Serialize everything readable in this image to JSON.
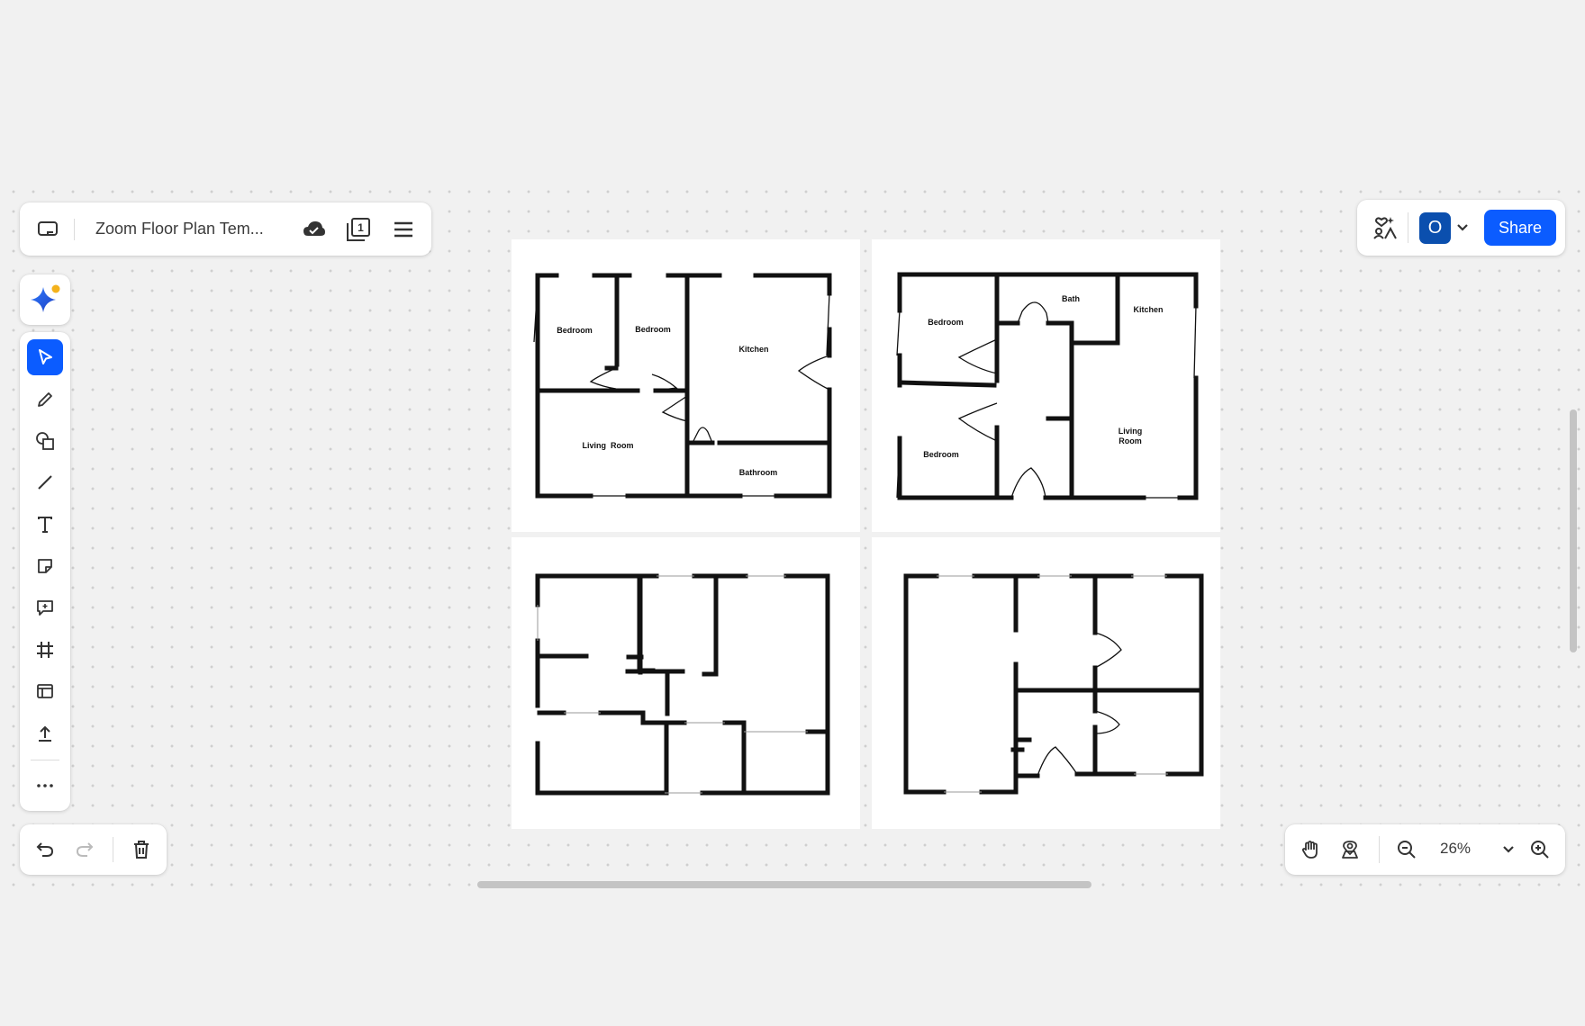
{
  "header": {
    "title": "Zoom Floor Plan Tem...",
    "back_icon": "board-back-icon",
    "cloud_icon": "cloud-saved-icon",
    "pages_icon": "pages-icon",
    "pages_count": "1",
    "menu_icon": "hamburger-menu-icon"
  },
  "ai_assistant": {
    "icon": "ai-sparkle-icon"
  },
  "toolbar": {
    "tools": [
      {
        "name": "select-tool",
        "icon": "pointer-icon",
        "active": true
      },
      {
        "name": "pen-tool",
        "icon": "pencil-icon"
      },
      {
        "name": "shapes-tool",
        "icon": "shapes-icon"
      },
      {
        "name": "line-tool",
        "icon": "line-icon"
      },
      {
        "name": "text-tool",
        "icon": "text-icon"
      },
      {
        "name": "sticky-note-tool",
        "icon": "sticky-note-icon"
      },
      {
        "name": "comment-tool",
        "icon": "comment-icon"
      },
      {
        "name": "frame-tool",
        "icon": "frame-icon"
      },
      {
        "name": "templates-tool",
        "icon": "template-icon"
      },
      {
        "name": "upload-tool",
        "icon": "upload-icon"
      },
      {
        "name": "more-tools",
        "icon": "more-icon"
      }
    ]
  },
  "history": {
    "undo_icon": "undo-icon",
    "redo_icon": "redo-icon",
    "delete_icon": "trash-icon"
  },
  "collab": {
    "ai_icon": "ai-people-icon",
    "avatar_initial": "O",
    "share_label": "Share"
  },
  "zoom": {
    "pan_icon": "hand-icon",
    "locate_icon": "map-pin-icon",
    "zoom_out_icon": "zoom-out-icon",
    "zoom_level": "26%",
    "zoom_in_icon": "zoom-in-icon"
  },
  "floor_plans": {
    "plan1": {
      "bedroom_a": "Bedroom",
      "bedroom_b": "Bedroom",
      "kitchen": "Kitchen",
      "living": "Living  Room",
      "bathroom": "Bathroom"
    },
    "plan2": {
      "bedroom_a": "Bedroom",
      "bath": "Bath",
      "kitchen": "Kitchen",
      "bedroom_b": "Bedroom",
      "living_1": "Living",
      "living_2": "Room"
    }
  },
  "colors": {
    "accent": "#0b5cff",
    "avatar": "#0b4fae",
    "canvas": "#f1f1f1"
  }
}
